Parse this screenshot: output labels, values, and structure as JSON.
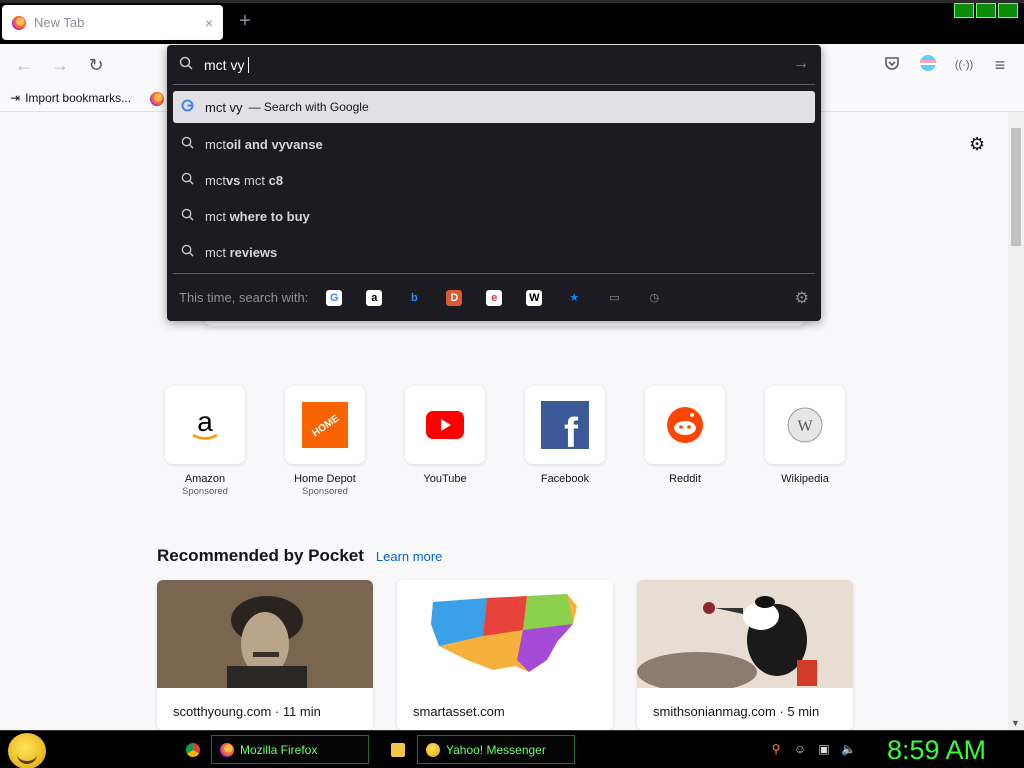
{
  "tab": {
    "title": "New Tab",
    "close": "×",
    "new_tab": "+"
  },
  "nav": {
    "back": "←",
    "forward": "→",
    "reload": "↻"
  },
  "bookmarks": {
    "import_label": "Import bookmarks..."
  },
  "urlbar": {
    "input_value": "mct vy",
    "selected": {
      "term": "mct vy",
      "engine_text": "— Search with Google"
    },
    "suggestions": [
      {
        "plain": "mct ",
        "bold": "oil and vy",
        "tail_plain": "",
        "tail_bold": "vanse"
      },
      {
        "plain": "mct ",
        "bold": "vs",
        "tail_plain": " mct ",
        "tail_bold": "c8"
      },
      {
        "plain": "mct ",
        "bold": "where to buy",
        "tail_plain": "",
        "tail_bold": ""
      },
      {
        "plain": "mct ",
        "bold": "reviews",
        "tail_plain": "",
        "tail_bold": ""
      }
    ],
    "search_with_label": "This time, search with:",
    "engines": [
      {
        "name": "google",
        "glyph": "G",
        "bg": "#ffffff",
        "fg": "#4285f4"
      },
      {
        "name": "amazon",
        "glyph": "a",
        "bg": "#ffffff",
        "fg": "#000000"
      },
      {
        "name": "bing",
        "glyph": "b",
        "bg": "transparent",
        "fg": "#2b8cf6"
      },
      {
        "name": "duckduckgo",
        "glyph": "D",
        "bg": "#de5833",
        "fg": "#ffffff"
      },
      {
        "name": "ebay",
        "glyph": "e",
        "bg": "#ffffff",
        "fg": "#e53238"
      },
      {
        "name": "wikipedia",
        "glyph": "W",
        "bg": "#ffffff",
        "fg": "#000000"
      },
      {
        "name": "bookmarks",
        "glyph": "★",
        "bg": "transparent",
        "fg": "#0a84ff"
      },
      {
        "name": "tabs",
        "glyph": "▭",
        "bg": "transparent",
        "fg": "#8f8f9d"
      },
      {
        "name": "history",
        "glyph": "◷",
        "bg": "transparent",
        "fg": "#8f8f9d"
      }
    ]
  },
  "topsites": [
    {
      "name": "Amazon",
      "sponsored": "Sponsored"
    },
    {
      "name": "Home Depot",
      "sponsored": "Sponsored"
    },
    {
      "name": "YouTube",
      "sponsored": ""
    },
    {
      "name": "Facebook",
      "sponsored": ""
    },
    {
      "name": "Reddit",
      "sponsored": ""
    },
    {
      "name": "Wikipedia",
      "sponsored": ""
    }
  ],
  "pocket": {
    "title": "Recommended by Pocket",
    "learn_more": "Learn more",
    "cards": [
      {
        "source": "scotthyoung.com · 11 min"
      },
      {
        "source": "smartasset.com"
      },
      {
        "source": "smithsonianmag.com · 5 min"
      }
    ]
  },
  "taskbar": {
    "firefox_label": "Mozilla Firefox",
    "yahoo_label": "Yahoo! Messenger",
    "clock": "8:59 AM"
  }
}
